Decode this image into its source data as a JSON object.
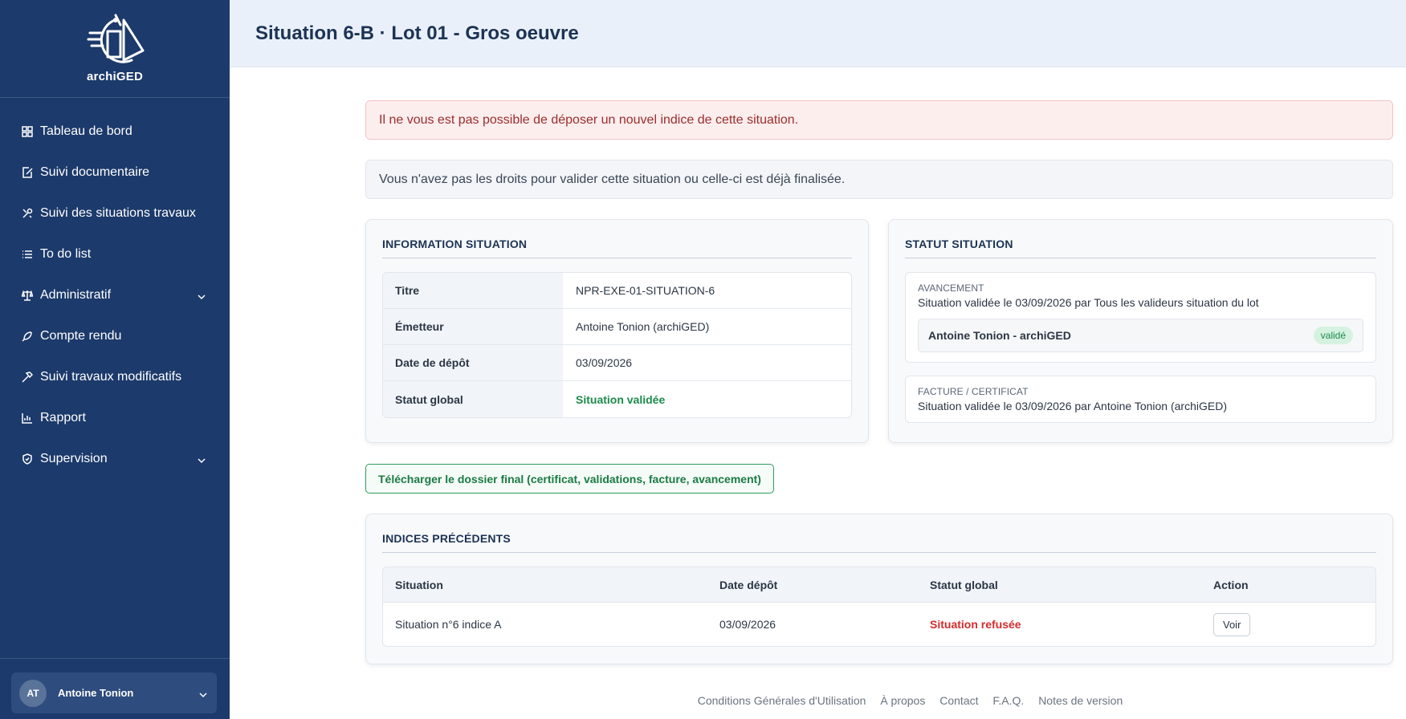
{
  "brand": {
    "name": "archiGED"
  },
  "sidebar": {
    "items": [
      {
        "label": "Tableau de bord",
        "icon": "grid-icon"
      },
      {
        "label": "Suivi documentaire",
        "icon": "document-edit-icon"
      },
      {
        "label": "Suivi des situations travaux",
        "icon": "tools-icon"
      },
      {
        "label": "To do list",
        "icon": "list-icon"
      },
      {
        "label": "Administratif",
        "icon": "scale-icon"
      },
      {
        "label": "Compte rendu",
        "icon": "feather-icon"
      },
      {
        "label": "Suivi travaux modificatifs",
        "icon": "hammer-icon"
      },
      {
        "label": "Rapport",
        "icon": "bar-chart-icon"
      },
      {
        "label": "Supervision",
        "icon": "shield-icon"
      }
    ]
  },
  "user": {
    "initials": "AT",
    "name": "Antoine Tonion"
  },
  "header": {
    "title": "Situation 6-B · Lot 01 - Gros oeuvre"
  },
  "alerts": {
    "danger": "Il ne vous est pas possible de déposer un nouvel indice de cette situation.",
    "info": "Vous n'avez pas les droits pour valider cette situation ou celle-ci est déjà finalisée."
  },
  "info": {
    "title": "INFORMATION SITUATION",
    "rows": [
      {
        "label": "Titre",
        "value": "NPR-EXE-01-SITUATION-6"
      },
      {
        "label": "Émetteur",
        "value": "Antoine Tonion (archiGED)"
      },
      {
        "label": "Date de dépôt",
        "value": "03/09/2026"
      },
      {
        "label": "Statut global",
        "value": "Situation validée"
      }
    ]
  },
  "status": {
    "title": "STATUT SITUATION",
    "avancement": {
      "caption": "AVANCEMENT",
      "text": "Situation validée le 03/09/2026 par Tous les valideurs situation du lot",
      "validator": "Antoine Tonion - archiGED",
      "badge": "validé"
    },
    "facture": {
      "caption": "FACTURE / CERTIFICAT",
      "text": "Situation validée le 03/09/2026 par Antoine Tonion (archiGED)"
    }
  },
  "download_label": "Télécharger le dossier final (certificat, validations, facture, avancement)",
  "previous": {
    "title": "INDICES PRÉCÉDENTS",
    "columns": [
      "Situation",
      "Date dépôt",
      "Statut global",
      "Action"
    ],
    "rows": [
      {
        "situation": "Situation n°6 indice A",
        "date": "03/09/2026",
        "status": "Situation refusée",
        "action": "Voir"
      }
    ]
  },
  "footer": {
    "links": [
      "Conditions Générales d'Utilisation",
      "À propos",
      "Contact",
      "F.A.Q.",
      "Notes de version"
    ]
  },
  "colors": {
    "sidebar": "#1c3a6b",
    "success": "#1b8a4b",
    "danger": "#d42c2c"
  }
}
